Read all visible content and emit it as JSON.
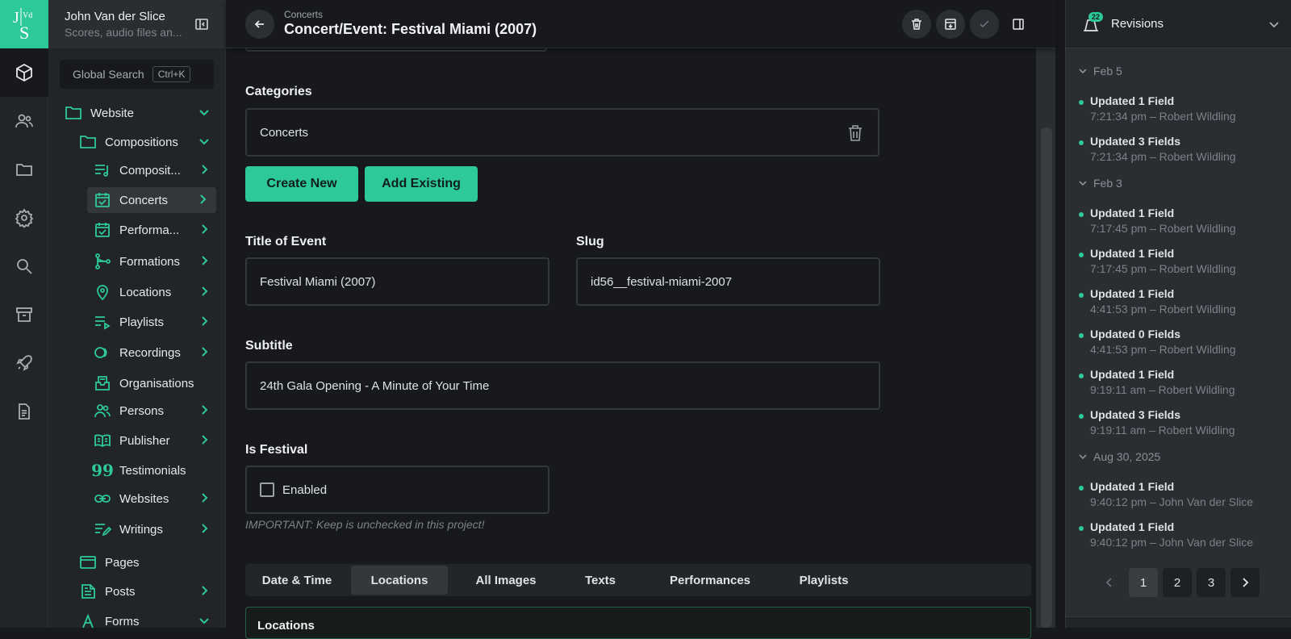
{
  "app": {
    "logo_text": "JVdS"
  },
  "user": {
    "name": "John Van der Slice",
    "subtitle": "Scores, audio files an..."
  },
  "search": {
    "label": "Global Search",
    "shortcut": "Ctrl+K"
  },
  "rail": [
    "cube-icon",
    "users-icon",
    "folder-icon",
    "gear-icon",
    "search-icon",
    "archive-icon",
    "rocket-icon",
    "document-icon"
  ],
  "tree": [
    {
      "label": "Website",
      "icon": "folder-icon"
    },
    {
      "label": "Compositions",
      "icon": "folder-icon"
    },
    {
      "label": "Composit...",
      "icon": "music-list-icon"
    },
    {
      "label": "Concerts",
      "icon": "calendar-check-icon"
    },
    {
      "label": "Performa...",
      "icon": "calendar-check-icon"
    },
    {
      "label": "Formations",
      "icon": "fork-icon"
    },
    {
      "label": "Locations",
      "icon": "pin-icon"
    },
    {
      "label": "Playlists",
      "icon": "playlist-icon"
    },
    {
      "label": "Recordings",
      "icon": "rings-icon"
    },
    {
      "label": "Organisations",
      "icon": "inbox-icon"
    },
    {
      "label": "Persons",
      "icon": "users-icon"
    },
    {
      "label": "Publisher",
      "icon": "book-icon"
    },
    {
      "label": "Testimonials",
      "icon": "quote-icon"
    },
    {
      "label": "Websites",
      "icon": "link-icon"
    },
    {
      "label": "Writings",
      "icon": "pen-list-icon"
    },
    {
      "label": "Pages",
      "icon": "window-icon"
    },
    {
      "label": "Posts",
      "icon": "post-icon"
    },
    {
      "label": "Forms",
      "icon": "forms-icon"
    }
  ],
  "header": {
    "breadcrumb": "Concerts",
    "title": "Concert/Event: Festival Miami (2007)"
  },
  "form": {
    "categories_label": "Categories",
    "categories_value": "Concerts",
    "create_new": "Create New",
    "add_existing": "Add Existing",
    "title_label": "Title of Event",
    "title_value": "Festival Miami (2007)",
    "slug_label": "Slug",
    "slug_value": "id56__festival-miami-2007",
    "subtitle_label": "Subtitle",
    "subtitle_value": "24th Gala Opening - A Minute of Your Time",
    "festival_label": "Is Festival",
    "festival_checkbox": "Enabled",
    "festival_hint": "IMPORTANT: Keep is unchecked in this project!"
  },
  "tabs": [
    "Date & Time",
    "Locations",
    "All Images",
    "Texts",
    "Performances",
    "Playlists"
  ],
  "active_tab": "Locations",
  "panel_title": "Locations",
  "revisions": {
    "title": "Revisions",
    "count": "22",
    "groups": [
      {
        "date": "Feb 5",
        "entries": [
          {
            "title": "Updated 1 Field",
            "meta": "7:21:34 pm – Robert Wildling"
          },
          {
            "title": "Updated 3 Fields",
            "meta": "7:21:34 pm – Robert Wildling"
          }
        ]
      },
      {
        "date": "Feb 3",
        "entries": [
          {
            "title": "Updated 1 Field",
            "meta": "7:17:45 pm – Robert Wildling"
          },
          {
            "title": "Updated 1 Field",
            "meta": "7:17:45 pm – Robert Wildling"
          },
          {
            "title": "Updated 1 Field",
            "meta": "4:41:53 pm – Robert Wildling"
          },
          {
            "title": "Updated 0 Fields",
            "meta": "4:41:53 pm – Robert Wildling"
          },
          {
            "title": "Updated 1 Field",
            "meta": "9:19:11 am – Robert Wildling"
          },
          {
            "title": "Updated 3 Fields",
            "meta": "9:19:11 am – Robert Wildling"
          }
        ]
      },
      {
        "date": "Aug 30, 2025",
        "entries": [
          {
            "title": "Updated 1 Field",
            "meta": "9:40:12 pm – John Van der Slice"
          },
          {
            "title": "Updated 1 Field",
            "meta": "9:40:12 pm – John Van der Slice"
          }
        ]
      }
    ],
    "pages": [
      "1",
      "2",
      "3"
    ]
  },
  "colors": {
    "accent": "#2ec99a",
    "bg": "#17191c",
    "panel": "#222528"
  }
}
